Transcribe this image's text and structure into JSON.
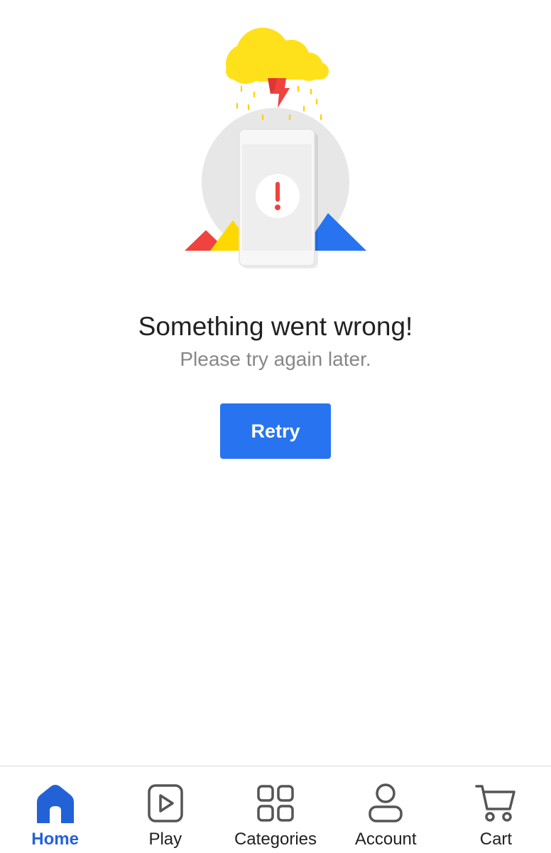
{
  "error": {
    "title": "Something went wrong!",
    "subtitle": "Please try again later.",
    "illustration_icon": "phone-error-storm-illustration"
  },
  "retry_button": {
    "label": "Retry"
  },
  "colors": {
    "accent": "#2874f0",
    "nav_active": "#2362d6",
    "cloud_yellow": "#ffe11b",
    "alert_red": "#f0423f",
    "mountain_blue": "#2874f0"
  },
  "bottom_nav": {
    "active": "home",
    "items": [
      {
        "id": "home",
        "label": "Home",
        "icon": "home-icon"
      },
      {
        "id": "play",
        "label": "Play",
        "icon": "play-icon"
      },
      {
        "id": "categories",
        "label": "Categories",
        "icon": "categories-icon"
      },
      {
        "id": "account",
        "label": "Account",
        "icon": "account-icon"
      },
      {
        "id": "cart",
        "label": "Cart",
        "icon": "cart-icon"
      }
    ]
  }
}
